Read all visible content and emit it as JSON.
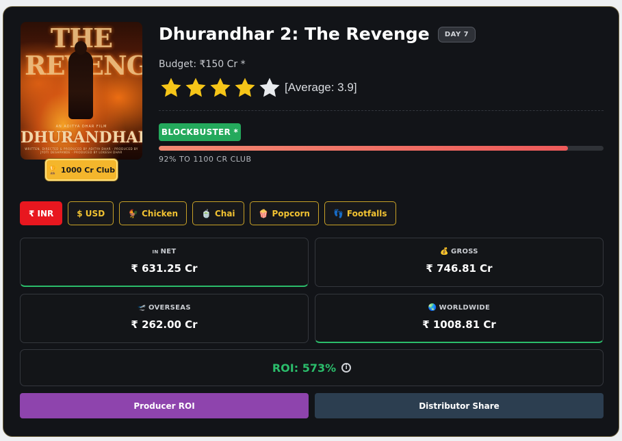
{
  "movie": {
    "title": "Dhurandhar 2: The Revenge",
    "day_badge": "DAY 7",
    "budget": "Budget: ₹150 Cr *",
    "rating": {
      "stars": 4,
      "max": 5,
      "average_text": "[Average: 3.9]"
    },
    "poster": {
      "title_top": "THE REVENGE",
      "tagline": "AN ADITYA DHAR FILM",
      "title_bottom": "DHURANDHAR",
      "credits": "WRITTEN, DIRECTED & PRODUCED BY ADITYA DHAR · PRODUCED BY JYOTI DESHPANDE · PRODUCED BY LOKESH DHAR"
    },
    "club_badge": {
      "icon": "trophy-icon",
      "label": "1000 Cr Club"
    }
  },
  "verdict": {
    "label": "BLOCKBUSTER *",
    "color": "#24a95c",
    "progress_percent": 92,
    "progress_label": "92% TO 1100 CR CLUB"
  },
  "currencies": [
    {
      "label": "₹ INR",
      "icon": "",
      "active": true
    },
    {
      "label": "$ USD",
      "icon": "",
      "active": false
    },
    {
      "label": "Chicken",
      "icon": "🐓",
      "active": false
    },
    {
      "label": "Chai",
      "icon": "🍵",
      "active": false
    },
    {
      "label": "Popcorn",
      "icon": "🍿",
      "active": false
    },
    {
      "label": "Footfalls",
      "icon": "👣",
      "active": false
    }
  ],
  "stats": {
    "net": {
      "icon": "IN",
      "label": "NET",
      "value": "₹ 631.25 Cr"
    },
    "gross": {
      "icon": "💰",
      "label": "GROSS",
      "value": "₹ 746.81 Cr"
    },
    "overseas": {
      "icon": "🛫",
      "label": "OVERSEAS",
      "value": "₹ 262.00 Cr"
    },
    "worldwide": {
      "icon": "🌏",
      "label": "WORLDWIDE",
      "value": "₹ 1008.81 Cr"
    }
  },
  "roi": {
    "text": "ROI: 573%",
    "info_icon": "i"
  },
  "actions": {
    "producer": "Producer ROI",
    "distributor": "Distributor Share"
  },
  "colors": {
    "accent_gold": "#f1c232",
    "active_red": "#e8171f",
    "roi_green": "#2bbd6b",
    "producer_purple": "#8e44ad",
    "distributor_navy": "#2c3e50"
  }
}
